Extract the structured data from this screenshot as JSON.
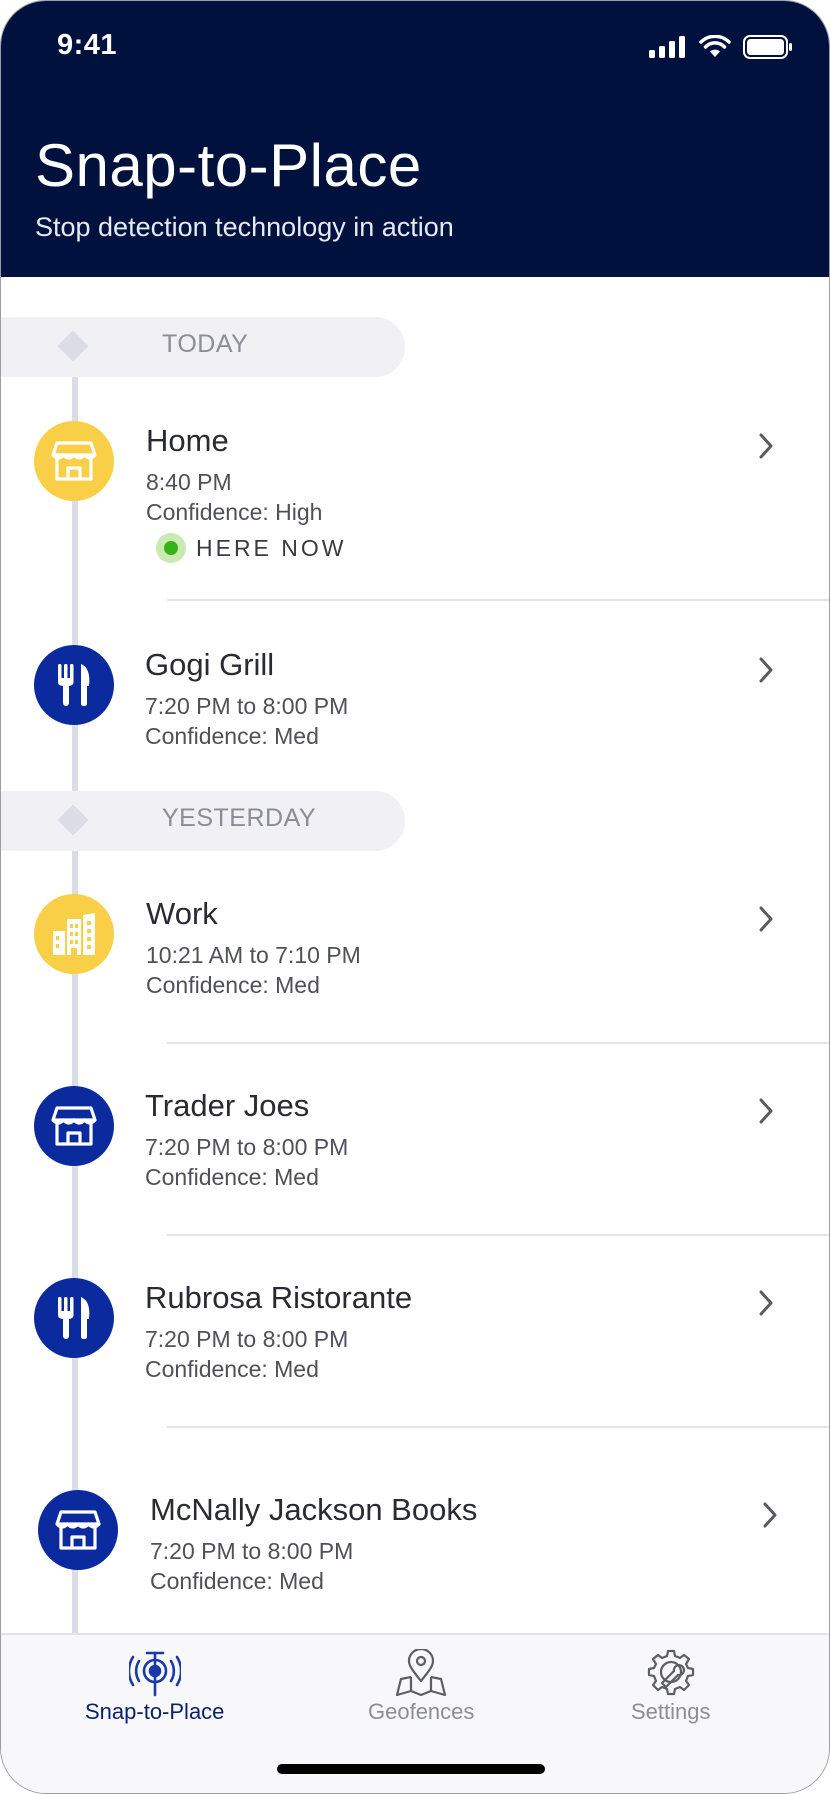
{
  "status_bar": {
    "time": "9:41"
  },
  "header": {
    "title": "Snap-to-Place",
    "subtitle": "Stop detection technology in action"
  },
  "sections": [
    {
      "label": "TODAY"
    },
    {
      "label": "YESTERDAY"
    }
  ],
  "items": [
    {
      "name": "Home",
      "time": "8:40 PM",
      "confidence": "Confidence: High",
      "status": "HERE NOW",
      "icon": "store-icon",
      "color": "#f9cf47"
    },
    {
      "name": "Gogi Grill",
      "time": "7:20 PM to 8:00 PM",
      "confidence": "Confidence: Med",
      "icon": "restaurant-icon",
      "color": "#0a2a9e"
    },
    {
      "name": "Work",
      "time": "10:21 AM to 7:10 PM",
      "confidence": "Confidence: Med",
      "icon": "office-building-icon",
      "color": "#f9cf47"
    },
    {
      "name": "Trader Joes",
      "time": "7:20 PM to 8:00 PM",
      "confidence": "Confidence: Med",
      "icon": "store-icon",
      "color": "#0a2a9e"
    },
    {
      "name": "Rubrosa Ristorante",
      "time": "7:20 PM to 8:00 PM",
      "confidence": "Confidence: Med",
      "icon": "restaurant-icon",
      "color": "#0a2a9e"
    },
    {
      "name": "McNally Jackson Books",
      "time": "7:20 PM to 8:00 PM",
      "confidence": "Confidence: Med",
      "icon": "store-icon",
      "color": "#0a2a9e"
    }
  ],
  "tabbar": {
    "tabs": [
      {
        "label": "Snap-to-Place",
        "icon": "radar-target-icon",
        "active": true
      },
      {
        "label": "Geofences",
        "icon": "map-pin-icon",
        "active": false
      },
      {
        "label": "Settings",
        "icon": "gear-wrench-icon",
        "active": false
      }
    ]
  },
  "colors": {
    "header_bg": "#00113d",
    "accent_yellow": "#f9cf47",
    "accent_blue": "#0a2a9e",
    "here_now_green": "#36b31a"
  }
}
